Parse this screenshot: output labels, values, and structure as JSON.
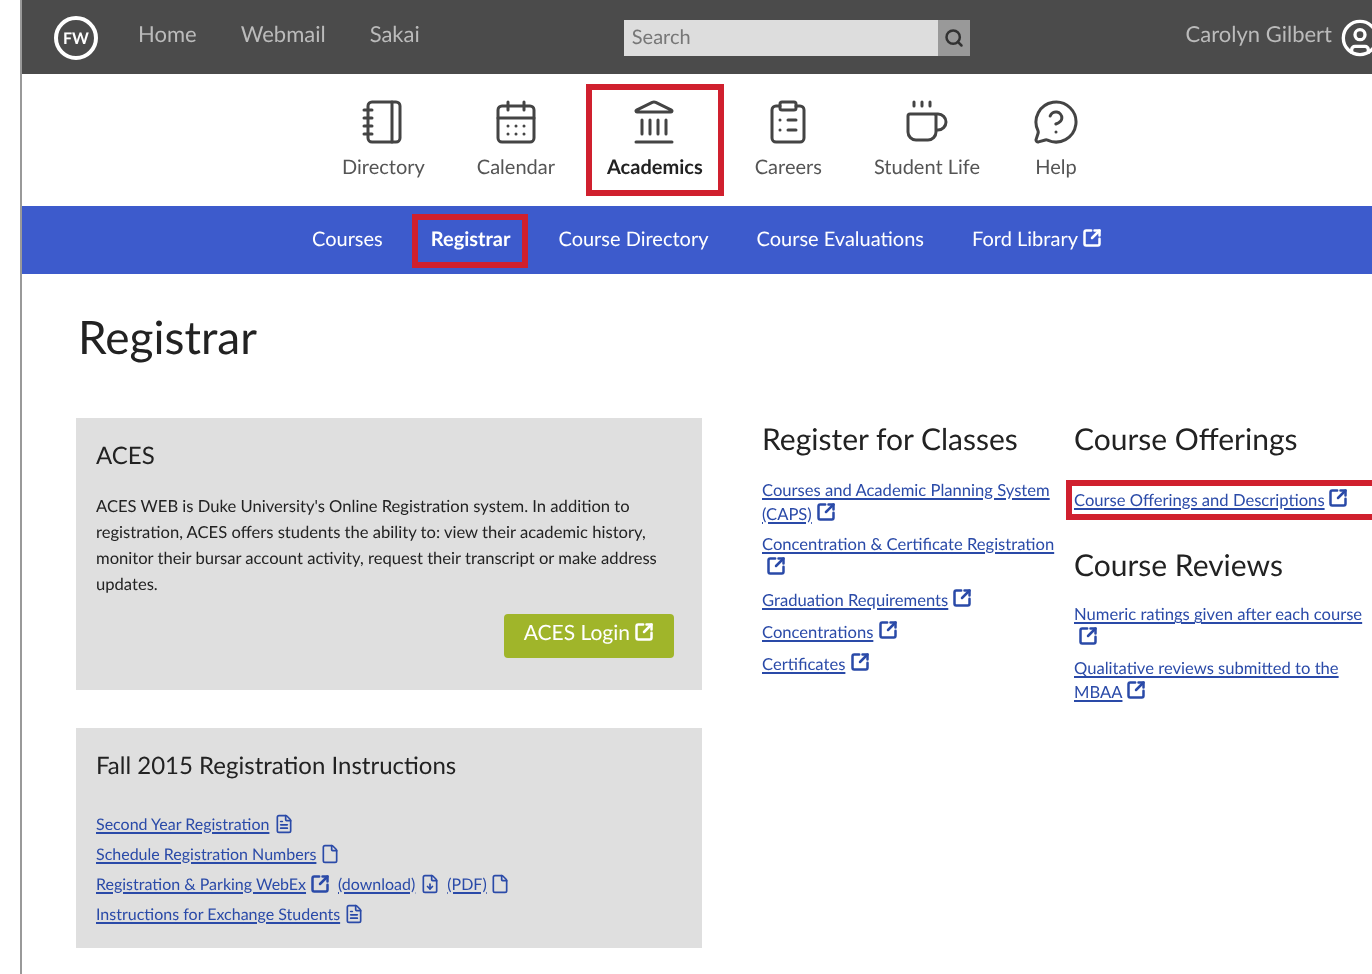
{
  "top_bar": {
    "logo": "FW",
    "links": [
      "Home",
      "Webmail",
      "Sakai"
    ],
    "search": {
      "placeholder": "Search"
    },
    "user": "Carolyn Gilbert"
  },
  "icon_nav": [
    {
      "label": "Directory",
      "selected": false,
      "highlighted": false
    },
    {
      "label": "Calendar",
      "selected": false,
      "highlighted": false
    },
    {
      "label": "Academics",
      "selected": true,
      "highlighted": true
    },
    {
      "label": "Careers",
      "selected": false,
      "highlighted": false
    },
    {
      "label": "Student Life",
      "selected": false,
      "highlighted": false
    },
    {
      "label": "Help",
      "selected": false,
      "highlighted": false
    }
  ],
  "sub_nav": [
    {
      "label": "Courses",
      "selected": false,
      "highlighted": false,
      "external": false
    },
    {
      "label": "Registrar",
      "selected": true,
      "highlighted": true,
      "external": false
    },
    {
      "label": "Course Directory",
      "selected": false,
      "highlighted": false,
      "external": false
    },
    {
      "label": "Course Evaluations",
      "selected": false,
      "highlighted": false,
      "external": false
    },
    {
      "label": "Ford Library",
      "selected": false,
      "highlighted": false,
      "external": true
    }
  ],
  "page_title": "Registrar",
  "aces": {
    "title": "ACES",
    "text": "ACES WEB is Duke University's Online Registration system. In addition to registration, ACES offers students the ability to: view their academic history, monitor their bursar account activity, request their transcript or make address updates.",
    "button": "ACES Login"
  },
  "instructions": {
    "title": "Fall 2015 Registration Instructions",
    "rows": [
      [
        {
          "label": "Second Year Registration",
          "kind": "doc"
        }
      ],
      [
        {
          "label": "Schedule Registration Numbers",
          "kind": "pdf"
        }
      ],
      [
        {
          "label": "Registration & Parking WebEx",
          "kind": "external"
        },
        {
          "label": "(download)",
          "kind": "file"
        },
        {
          "label": "(PDF)",
          "kind": "pdf"
        }
      ],
      [
        {
          "label": "Instructions for Exchange Students",
          "kind": "doc"
        }
      ]
    ]
  },
  "section_columns": [
    [
      {
        "title": "Register for Classes",
        "links": [
          {
            "label": "Courses and Academic Planning System (CAPS)",
            "highlighted": false
          },
          {
            "label": "Concentration & Certificate Registration",
            "highlighted": false
          },
          {
            "label": "Graduation Requirements",
            "highlighted": false
          },
          {
            "label": "Concentrations",
            "highlighted": false
          },
          {
            "label": "Certificates",
            "highlighted": false
          }
        ]
      }
    ],
    [
      {
        "title": "Course Offerings",
        "links": [
          {
            "label": "Course Offerings and Descriptions",
            "highlighted": true
          }
        ]
      },
      {
        "title": "Course Reviews",
        "links": [
          {
            "label": "Numeric ratings given after each course",
            "highlighted": false
          },
          {
            "label": "Qualitative reviews submitted to the MBAA",
            "highlighted": false
          }
        ]
      }
    ]
  ]
}
